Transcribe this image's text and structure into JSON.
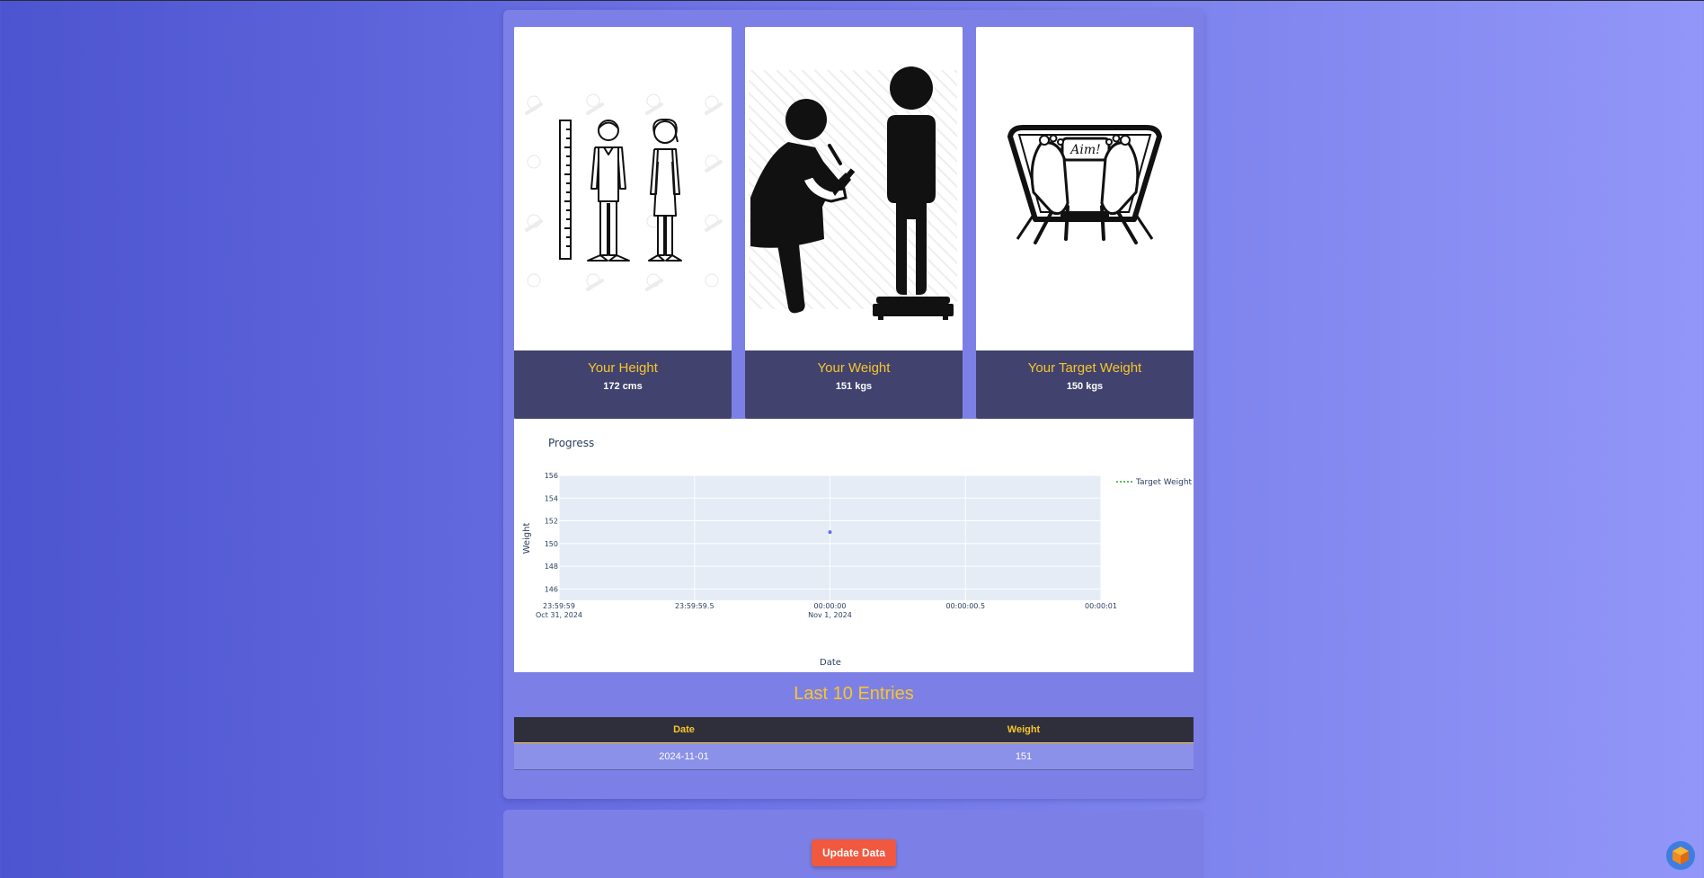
{
  "cards": [
    {
      "title": "Your Height",
      "value": "172 cms",
      "icon": "height-measure-icon"
    },
    {
      "title": "Your Weight",
      "value": "151 kgs",
      "icon": "weighing-person-icon"
    },
    {
      "title": "Your Target Weight",
      "value": "150 kgs",
      "icon": "bathroom-scale-icon"
    }
  ],
  "scale_text": "Aim!",
  "chart": {
    "title": "Progress",
    "xlabel": "Date",
    "ylabel": "Weight",
    "legend_label": "Target Weight",
    "y_ticks": [
      "156",
      "154",
      "152",
      "150",
      "148",
      "146"
    ],
    "x_ticks": [
      {
        "l1": "23:59:59",
        "l2": "Oct 31, 2024"
      },
      {
        "l1": "23:59:59.5",
        "l2": ""
      },
      {
        "l1": "00:00:00",
        "l2": "Nov 1, 2024"
      },
      {
        "l1": "00:00:00.5",
        "l2": ""
      },
      {
        "l1": "00:00:01",
        "l2": ""
      }
    ]
  },
  "chart_data": {
    "type": "scatter",
    "title": "Progress",
    "xlabel": "Date",
    "ylabel": "Weight",
    "x": [
      "2024-11-01 00:00:00"
    ],
    "y": [
      151
    ],
    "ylim": [
      145,
      156
    ],
    "xlim": [
      "2024-10-31 23:59:59",
      "2024-11-01 00:00:01"
    ],
    "legend": [
      "Target Weight"
    ],
    "legend_position": "top-right",
    "grid": true,
    "colors": {
      "point": "#636efa",
      "target_line": "#2ca02c"
    }
  },
  "entries": {
    "title": "Last 10 Entries",
    "columns": [
      "Date",
      "Weight"
    ],
    "rows": [
      [
        "2024-11-01",
        "151"
      ]
    ]
  },
  "update_button": "Update Data",
  "colors": {
    "accent": "#f7c52b",
    "caption_bg": "#41436e",
    "button": "#f0583f",
    "panel": "#7c80e6"
  }
}
